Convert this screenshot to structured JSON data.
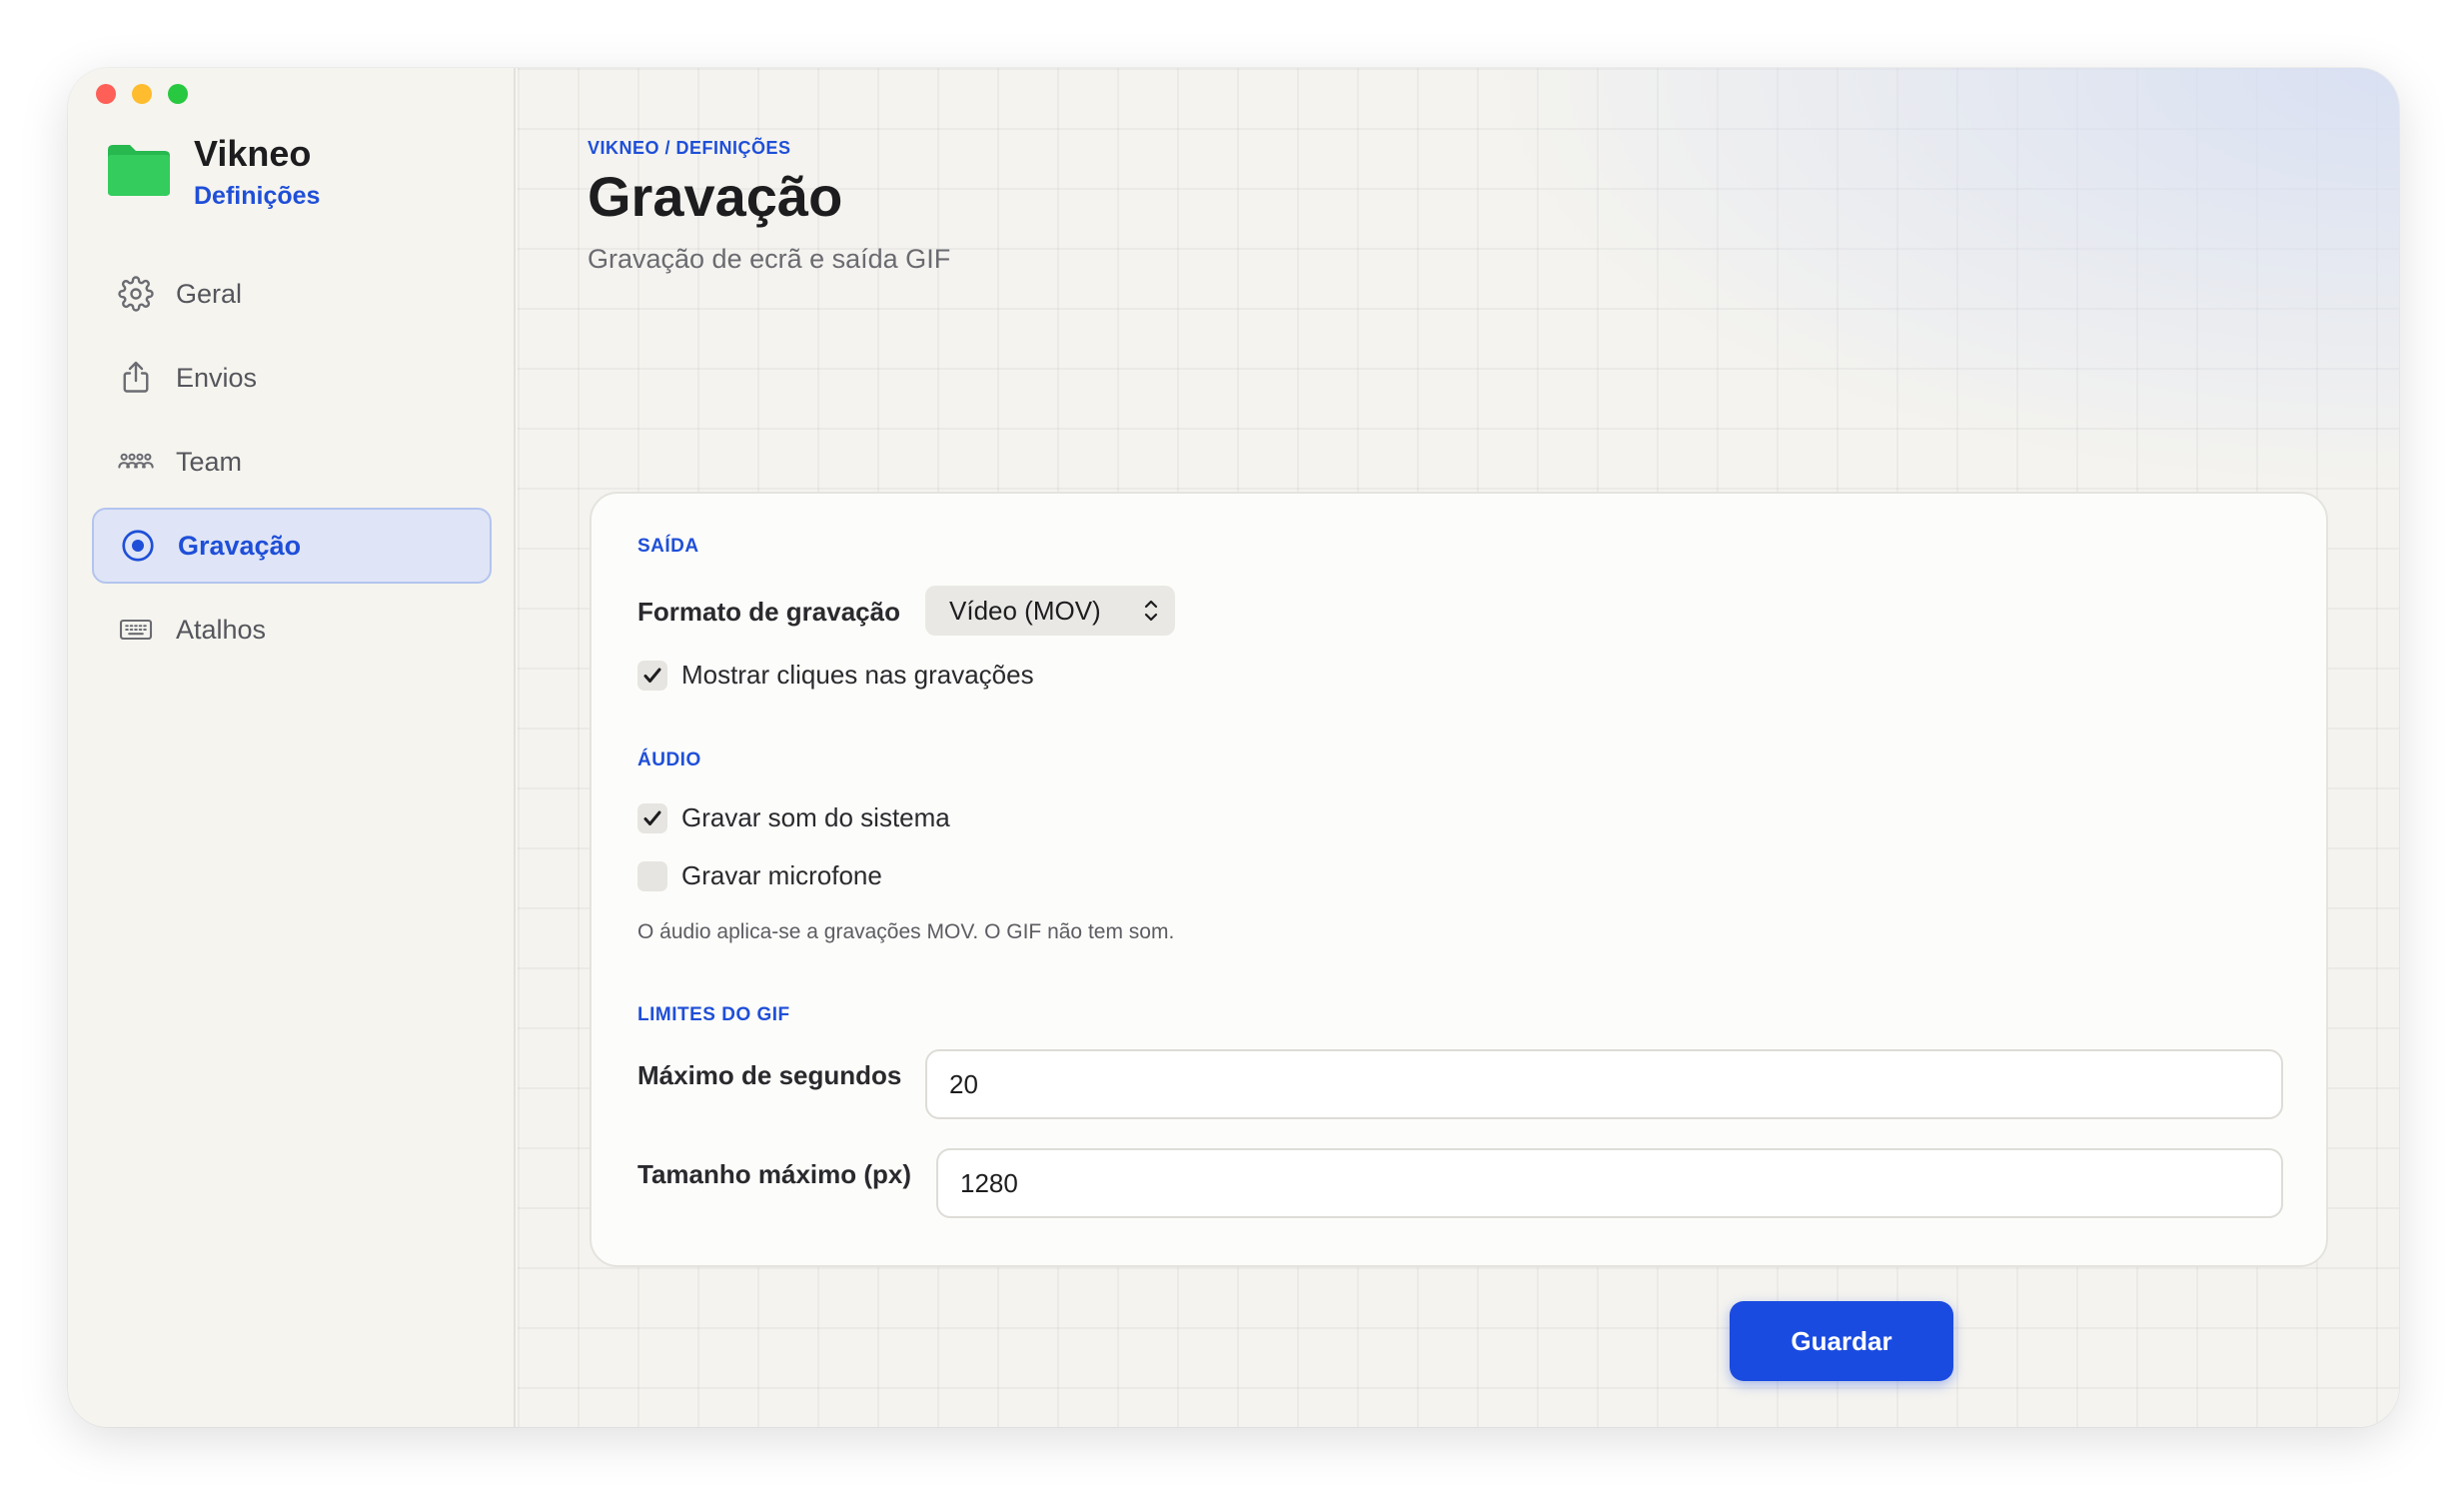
{
  "app": {
    "name": "Vikneo",
    "subtitle": "Definições"
  },
  "sidebar": {
    "items": [
      {
        "label": "Geral",
        "icon": "gear-icon",
        "active": false
      },
      {
        "label": "Envios",
        "icon": "share-icon",
        "active": false
      },
      {
        "label": "Team",
        "icon": "people-icon",
        "active": false
      },
      {
        "label": "Gravação",
        "icon": "record-icon",
        "active": true
      },
      {
        "label": "Atalhos",
        "icon": "keyboard-icon",
        "active": false
      }
    ]
  },
  "header": {
    "breadcrumb": "VIKNEO / DEFINIÇÕES",
    "title": "Gravação",
    "subtitle": "Gravação de ecrã e saída GIF"
  },
  "output": {
    "section_label": "SAÍDA",
    "format_label": "Formato de gravação",
    "format_value": "Vídeo (MOV)",
    "show_clicks_label": "Mostrar cliques nas gravações",
    "show_clicks_checked": true
  },
  "audio": {
    "section_label": "ÁUDIO",
    "system_sound_label": "Gravar som do sistema",
    "system_sound_checked": true,
    "microphone_label": "Gravar microfone",
    "microphone_checked": false,
    "note": "O áudio aplica-se a gravações MOV. O GIF não tem som."
  },
  "gif_limits": {
    "section_label": "LIMITES DO GIF",
    "max_seconds_label": "Máximo de segundos",
    "max_seconds_value": "20",
    "max_size_label": "Tamanho máximo (px)",
    "max_size_value": "1280"
  },
  "actions": {
    "save_label": "Guardar"
  },
  "colors": {
    "accent": "#1f4fd8",
    "button": "#1a4be0",
    "folder": "#2ec458"
  }
}
